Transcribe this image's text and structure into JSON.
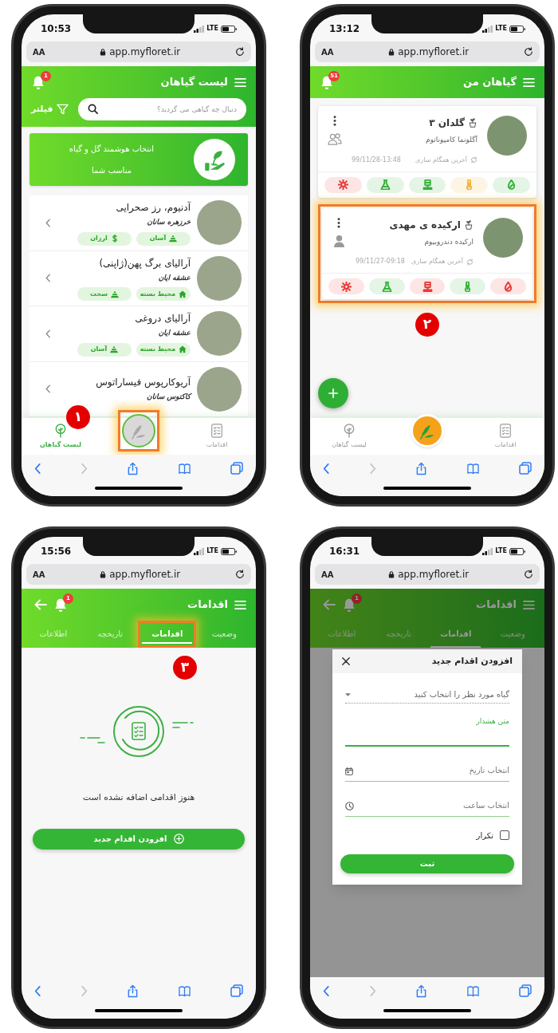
{
  "plant_list_screen": {
    "kind": "plant_list",
    "time": "10:53",
    "network": "LTE",
    "text_size": "AA",
    "url": "app.myfloret.ir",
    "callout": "۱",
    "header": {
      "title": "لیست گیاهان",
      "notification_count": "1"
    },
    "search": {
      "placeholder": "دنبال چه گیاهی می گردید؟"
    },
    "filter": "فیلتر",
    "banner": {
      "lines": [
        "انتخاب هوشمند گل و گیاه",
        "مناسب شما"
      ]
    },
    "plants": [
      {
        "name": "آدنیوم، رز صحرایی",
        "family": "خرزهره سانان",
        "tags": [
          {
            "kind": "difficulty",
            "label": "آسان"
          },
          {
            "kind": "price",
            "label": "ارزان"
          }
        ]
      },
      {
        "name": "آرالیای برگ پهن(ژاپنی)",
        "family": "عشقه ایان",
        "tags": [
          {
            "kind": "environment",
            "label": "محیط بسته"
          },
          {
            "kind": "difficulty",
            "label": "سخت"
          }
        ]
      },
      {
        "name": "آرالیای دروغی",
        "family": "عشقه ایان",
        "tags": [
          {
            "kind": "environment",
            "label": "محیط بسته"
          },
          {
            "kind": "difficulty",
            "label": "آسان"
          }
        ]
      },
      {
        "name": "آریوکارپوس فیساراتوس",
        "family": "کاکتوس سانان"
      }
    ],
    "bottom_nav": {
      "items": [
        {
          "kind": "actions",
          "label": "اقدامات",
          "selected": false
        },
        {
          "kind": "plants",
          "label": "لیست گیاهان",
          "selected": true
        }
      ],
      "center": {
        "active": false,
        "highlighted": true
      }
    }
  },
  "my_plants_screen": {
    "kind": "my_plants",
    "time": "13:12",
    "network": "LTE",
    "text_size": "AA",
    "url": "app.myfloret.ir",
    "callout": "۲",
    "header": {
      "title": "گیاهان من",
      "notification_count": "51"
    },
    "cards": [
      {
        "name": "گلدان ۳",
        "species": "آگلونما کامپوناتوم",
        "sync_label": "آخرین همگام سازی",
        "sync_time": "99/11/28-13:48",
        "shared": true,
        "highlighted": false,
        "sensors": [
          {
            "kind": "humidity",
            "color": "#35b23a"
          },
          {
            "kind": "temperature",
            "color": "#f2b233"
          },
          {
            "kind": "soil",
            "color": "#35b23a"
          },
          {
            "kind": "nutrients",
            "color": "#35b23a"
          },
          {
            "kind": "light",
            "color": "#e53935"
          }
        ]
      },
      {
        "name": "ارکیده ی مهدی",
        "species": "ارکیده دندروبیوم",
        "sync_label": "آخرین همگام سازی",
        "sync_time": "99/11/27-09:18",
        "shared": false,
        "highlighted": true,
        "sensors": [
          {
            "kind": "humidity",
            "color": "#e53935"
          },
          {
            "kind": "temperature",
            "color": "#35b23a"
          },
          {
            "kind": "soil",
            "color": "#e53935"
          },
          {
            "kind": "nutrients",
            "color": "#35b23a"
          },
          {
            "kind": "light",
            "color": "#e53935"
          }
        ]
      }
    ],
    "bottom_nav": {
      "items": [
        {
          "kind": "actions",
          "label": "اقدامات",
          "selected": false
        },
        {
          "kind": "plants",
          "label": "لیست گیاهان",
          "selected": false
        }
      ],
      "center": {
        "active": true,
        "highlighted": false
      }
    }
  },
  "actions_screen": {
    "kind": "actions",
    "time": "15:56",
    "network": "LTE",
    "text_size": "AA",
    "url": "app.myfloret.ir",
    "callout": "۳",
    "dimmed": false,
    "header": {
      "title": "اقدامات",
      "notification_count": "1"
    },
    "tabs": [
      {
        "label": "وضعیت",
        "selected": false,
        "highlighted": false
      },
      {
        "label": "اقدامات",
        "selected": true,
        "highlighted": true
      },
      {
        "label": "تاریخچه",
        "selected": false,
        "highlighted": false
      },
      {
        "label": "اطلاعات",
        "selected": false,
        "highlighted": false
      }
    ],
    "empty_message": "هنوز اقدامی اضافه نشده است",
    "add_button": "افزودن اقدام جدید"
  },
  "add_action_screen": {
    "kind": "actions",
    "time": "16:31",
    "network": "LTE",
    "text_size": "AA",
    "url": "app.myfloret.ir",
    "dimmed": true,
    "header": {
      "title": "اقدامات",
      "notification_count": "1"
    },
    "tabs": [
      {
        "label": "وضعیت",
        "selected": false,
        "highlighted": false
      },
      {
        "label": "اقدامات",
        "selected": true,
        "highlighted": false
      },
      {
        "label": "تاریخچه",
        "selected": false,
        "highlighted": false
      },
      {
        "label": "اطلاعات",
        "selected": false,
        "highlighted": false
      }
    ],
    "dialog": {
      "title": "افزودن اقدام جدید",
      "fields": [
        {
          "kind": "select",
          "placeholder": "گیاه مورد نظر را انتخاب کنید"
        },
        {
          "kind": "text",
          "label": "متن هشدار",
          "focused": true
        },
        {
          "kind": "date",
          "placeholder": "انتخاب تاریخ"
        },
        {
          "kind": "time",
          "placeholder": "انتخاب ساعت"
        }
      ],
      "repeat": {
        "label": "تکرار",
        "checked": false
      },
      "submit": "ثبت"
    }
  }
}
